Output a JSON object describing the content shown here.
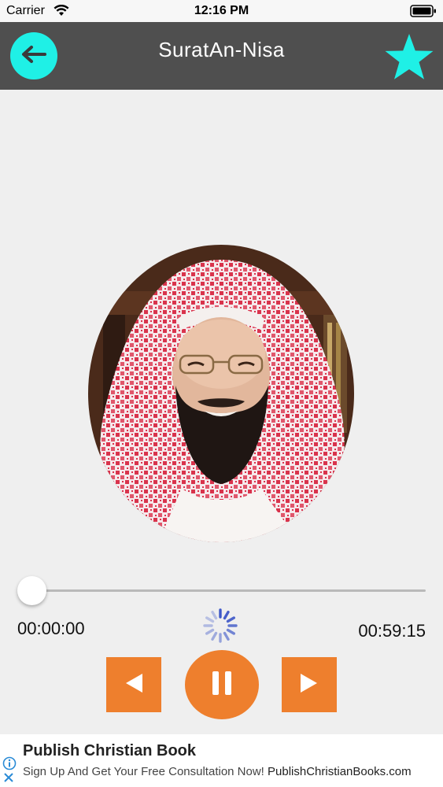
{
  "status_bar": {
    "carrier": "Carrier",
    "time": "12:16 PM",
    "icons": [
      "wifi-icon",
      "battery-icon"
    ]
  },
  "nav": {
    "title": "SuratAn-Nisa",
    "back_icon": "arrow-left-icon",
    "favorite_icon": "star-icon",
    "accent_color": "#1ff0e6",
    "bar_color": "#4f4f4f"
  },
  "player": {
    "progress": 0,
    "elapsed": "00:00:00",
    "duration": "00:59:15",
    "loading": true,
    "controls": {
      "prev_icon": "triangle-left-icon",
      "pause_icon": "pause-icon",
      "next_icon": "triangle-right-icon",
      "color": "#ee7f2d"
    }
  },
  "ad": {
    "title": "Publish Christian Book",
    "subtitle_prefix": "Sign Up And Get Your Free Consultation Now! ",
    "subtitle_domain": "PublishChristianBooks.com",
    "info_icon": "info-icon",
    "close_icon": "close-icon"
  }
}
